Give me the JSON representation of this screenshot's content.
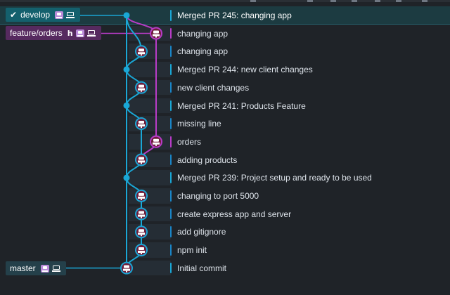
{
  "colors": {
    "main_branch": "#1aa7d6",
    "feature_branch": "#b83cc7",
    "row_selected": "#1c3b41",
    "row_tint": "#252d35",
    "develop_label": "#14606d",
    "feature_label": "#562a5f",
    "master_label": "#24404a"
  },
  "branches": {
    "develop": {
      "name": "develop",
      "checked_out": true,
      "check_icon": "check-icon",
      "user_icon": "user-avatar-icon",
      "local_icon": "laptop-icon"
    },
    "feature": {
      "name": "feature/orders",
      "checked_out": false,
      "remote_icon": "hourglass-icon",
      "user_icon": "user-avatar-icon",
      "local_icon": "laptop-icon"
    },
    "master": {
      "name": "master",
      "checked_out": false,
      "user_icon": "user-avatar-icon",
      "local_icon": "laptop-icon"
    }
  },
  "commits": [
    {
      "message": "Merged PR 245: changing app",
      "kind": "merge",
      "lane": "main",
      "selected": true
    },
    {
      "message": "changing app",
      "kind": "commit",
      "lane": "feature",
      "selected": false
    },
    {
      "message": "changing app",
      "kind": "commit",
      "lane": "side",
      "selected": false
    },
    {
      "message": "Merged PR 244: new client changes",
      "kind": "merge",
      "lane": "main",
      "selected": false
    },
    {
      "message": "new client changes",
      "kind": "commit",
      "lane": "side",
      "selected": false
    },
    {
      "message": "Merged PR 241: Products Feature",
      "kind": "merge",
      "lane": "main",
      "selected": false
    },
    {
      "message": "missing line",
      "kind": "commit",
      "lane": "side",
      "selected": false
    },
    {
      "message": "orders",
      "kind": "commit",
      "lane": "feature",
      "selected": false
    },
    {
      "message": "adding products",
      "kind": "commit",
      "lane": "side",
      "selected": false
    },
    {
      "message": "Merged PR 239: Project setup and ready to be used",
      "kind": "merge",
      "lane": "main",
      "selected": false
    },
    {
      "message": "changing to port 5000",
      "kind": "commit",
      "lane": "side",
      "selected": false
    },
    {
      "message": "create express app and server",
      "kind": "commit",
      "lane": "side",
      "selected": false
    },
    {
      "message": "add gitignore",
      "kind": "commit",
      "lane": "side",
      "selected": false
    },
    {
      "message": "npm init",
      "kind": "commit",
      "lane": "side",
      "selected": false
    },
    {
      "message": "Initial commit",
      "kind": "root",
      "lane": "main",
      "selected": false
    }
  ]
}
